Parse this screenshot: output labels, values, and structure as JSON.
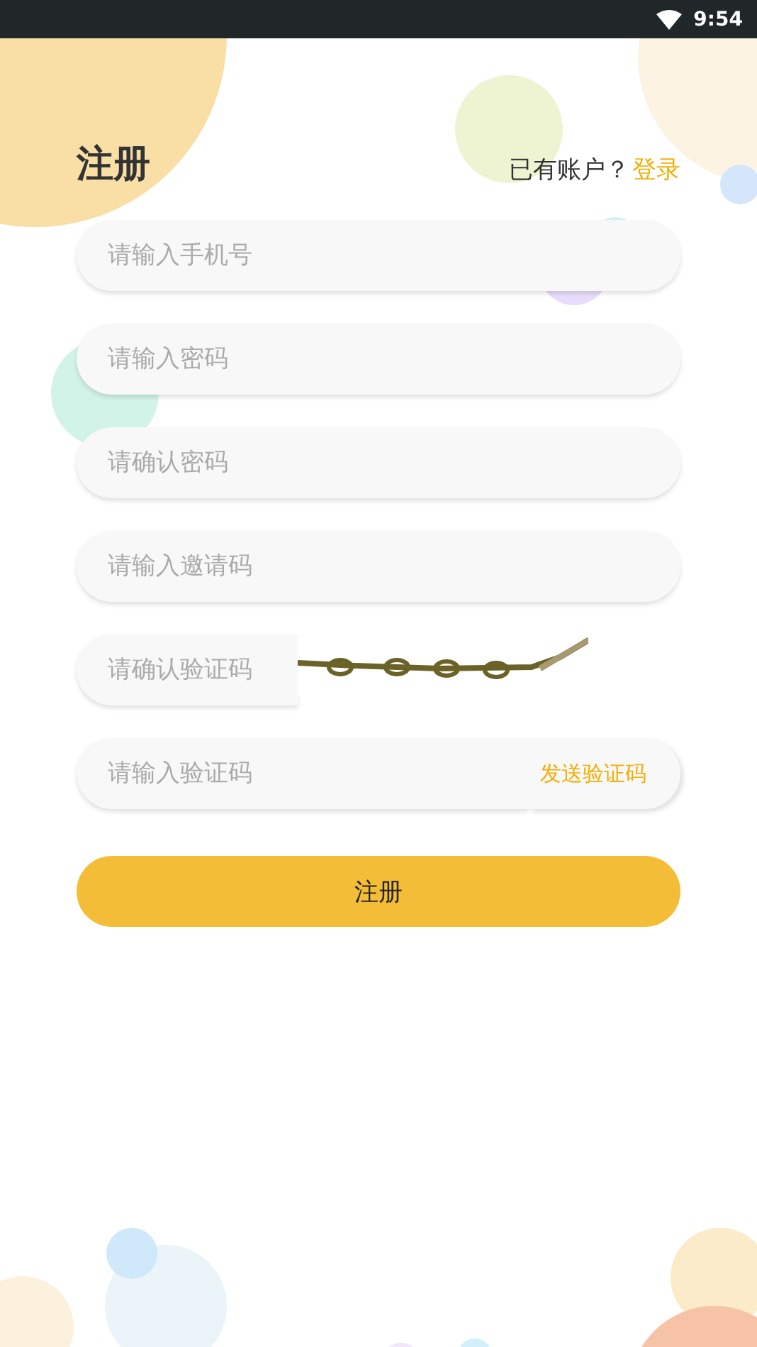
{
  "status_bar": {
    "time": "9:54"
  },
  "header": {
    "title": "注册",
    "prompt": "已有账户？",
    "login_link": "登录"
  },
  "fields": [
    {
      "kind": "text",
      "placeholder": "请输入手机号"
    },
    {
      "kind": "password",
      "placeholder": "请输入密码"
    },
    {
      "kind": "password",
      "placeholder": "请确认密码"
    },
    {
      "kind": "text",
      "placeholder": "请输入邀请码"
    },
    {
      "kind": "captcha",
      "placeholder": "请确认验证码"
    },
    {
      "kind": "sms",
      "placeholder": "请输入验证码",
      "action": "发送验证码"
    }
  ],
  "submit": "注册"
}
